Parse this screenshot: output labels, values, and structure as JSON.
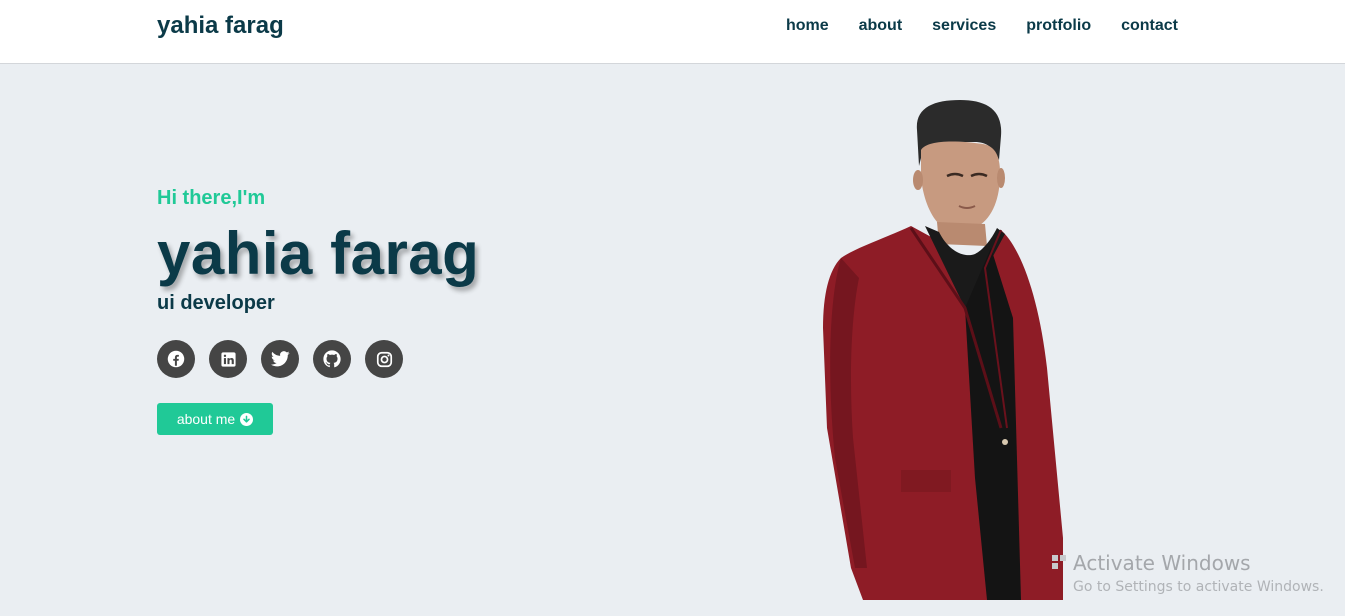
{
  "header": {
    "brand": "yahia farag",
    "nav": [
      "home",
      "about",
      "services",
      "protfolio",
      "contact"
    ]
  },
  "hero": {
    "greeting": "Hi there,I'm",
    "name": "yahia farag",
    "role": "ui developer",
    "cta_label": "about me",
    "socials": [
      "facebook-icon",
      "linkedin-icon",
      "twitter-icon",
      "github-icon",
      "instagram-icon"
    ]
  },
  "watermark": {
    "title": "Activate Windows",
    "subtitle": "Go to Settings to activate Windows."
  },
  "colors": {
    "accent": "#20c997",
    "dark": "#0b3a48",
    "background": "#eaeef2",
    "social_bg": "#454545",
    "jacket": "#8e1c26"
  }
}
